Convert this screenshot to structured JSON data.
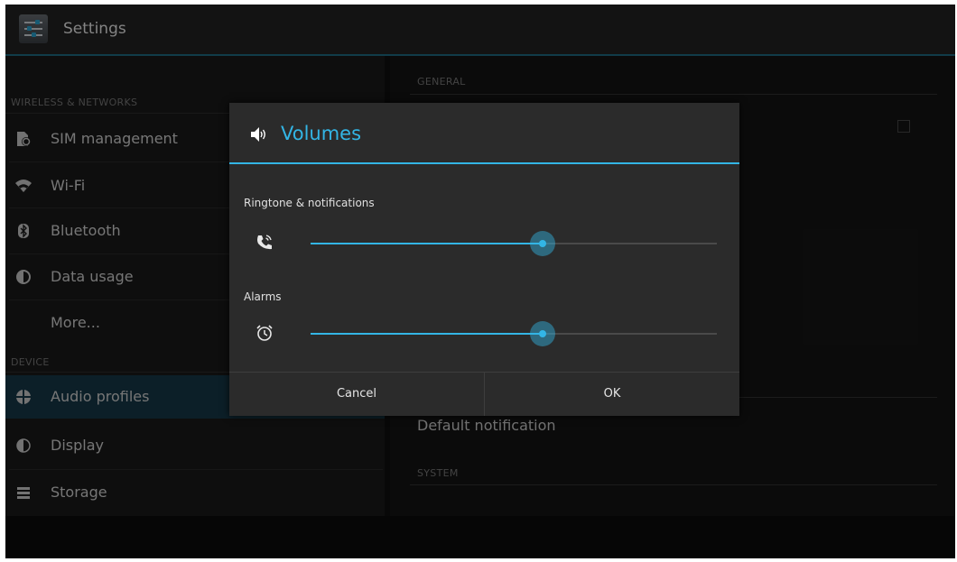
{
  "app": {
    "title": "Settings",
    "icon": "settings-sliders-icon"
  },
  "left_pane": {
    "sections": [
      {
        "header": "WIRELESS & NETWORKS"
      },
      {
        "header": "DEVICE"
      }
    ],
    "items": [
      {
        "label": "SIM management",
        "icon": "sim-management-icon"
      },
      {
        "label": "Wi-Fi",
        "icon": "wifi-icon"
      },
      {
        "label": "Bluetooth",
        "icon": "bluetooth-icon"
      },
      {
        "label": "Data usage",
        "icon": "data-usage-icon"
      },
      {
        "label": "More...",
        "icon": ""
      },
      {
        "label": "Audio profiles",
        "icon": "audio-profiles-icon",
        "selected": true
      },
      {
        "label": "Display",
        "icon": "display-icon"
      },
      {
        "label": "Storage",
        "icon": "storage-icon"
      }
    ]
  },
  "right_pane": {
    "general_header": "GENERAL",
    "default_notification": "Default notification",
    "system_header": "SYSTEM"
  },
  "dialog": {
    "title": "Volumes",
    "title_icon": "volume-icon",
    "sliders": [
      {
        "label": "Ringtone & notifications",
        "icon": "ringtone-icon",
        "value": 0.57
      },
      {
        "label": "Alarms",
        "icon": "alarm-clock-icon",
        "value": 0.57
      }
    ],
    "cancel_label": "Cancel",
    "ok_label": "OK"
  },
  "colors": {
    "accent": "#33b5e5",
    "selected_bg": "#16394a",
    "background": "#101010"
  }
}
